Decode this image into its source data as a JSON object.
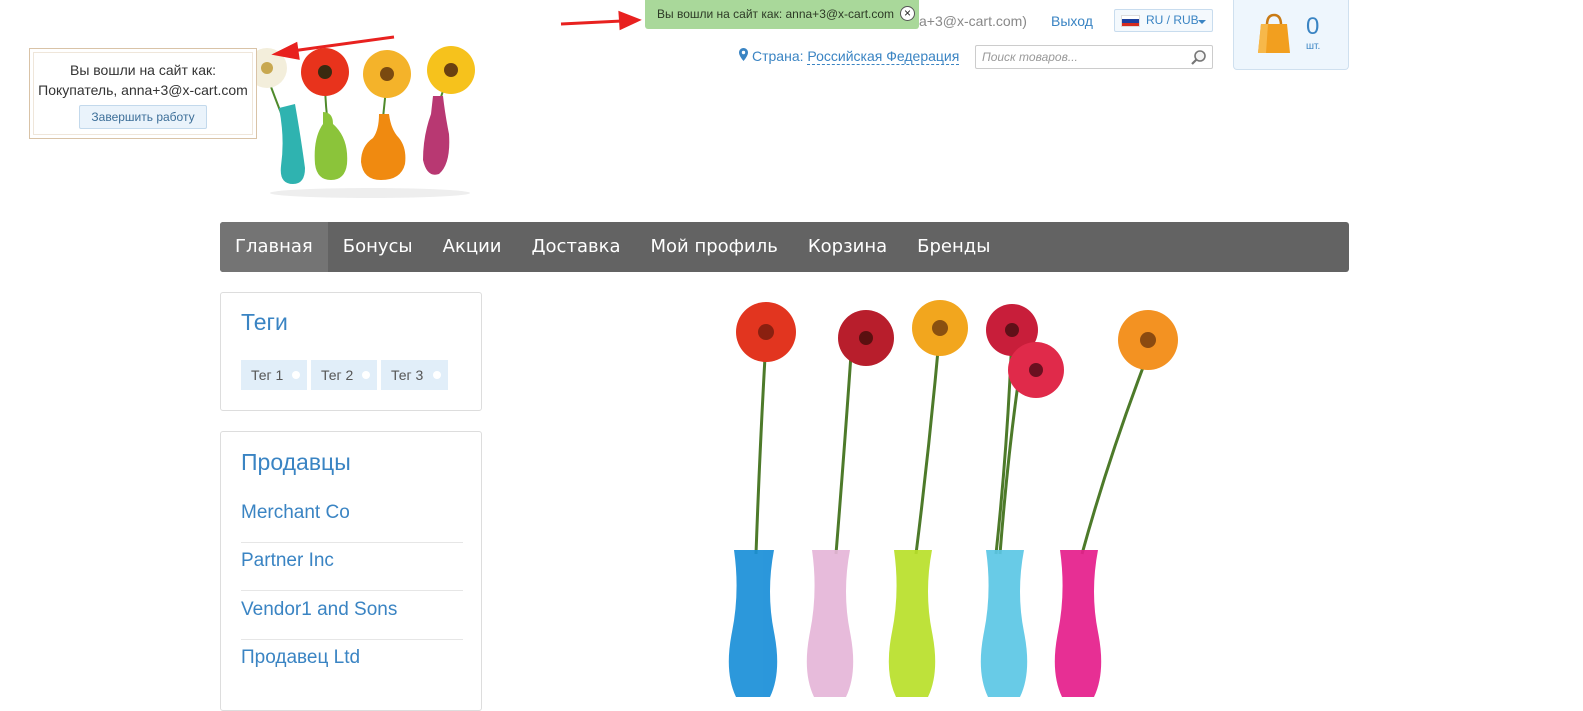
{
  "impersonation_panel": {
    "line1": "Вы вошли на сайт как:",
    "line2": "Покупатель, anna+3@x-cart.com",
    "finish_button": "Завершить работу"
  },
  "notification": {
    "text": "Вы вошли на сайт как: anna+3@x-cart.com",
    "close_icon": "close-icon",
    "background": "#a9d89a"
  },
  "header": {
    "account_tail": "a+3@x-cart.com)",
    "logout": "Выход",
    "language": {
      "label": "RU / RUB",
      "flag_icon": "russia-flag-icon"
    },
    "country": {
      "label": "Страна:",
      "value": "Российская Федерация",
      "icon": "map-pin-icon"
    },
    "search": {
      "placeholder": "Поиск товаров...",
      "value": "",
      "icon": "search-icon"
    },
    "cart": {
      "count": "0",
      "unit": "шт.",
      "icon": "shopping-bag-icon"
    }
  },
  "nav": {
    "items": [
      {
        "label": "Главная",
        "active": true
      },
      {
        "label": "Бонусы"
      },
      {
        "label": "Акции"
      },
      {
        "label": "Доставка"
      },
      {
        "label": "Мой профиль"
      },
      {
        "label": "Корзина"
      },
      {
        "label": "Бренды"
      }
    ]
  },
  "sidebar": {
    "tags": {
      "title": "Теги",
      "items": [
        "Тег 1",
        "Тег 2",
        "Тег 3"
      ]
    },
    "vendors": {
      "title": "Продавцы",
      "items": [
        "Merchant Co",
        "Partner Inc",
        "Vendor1 and Sons",
        "Продавец Ltd"
      ]
    }
  },
  "colors": {
    "accent": "#3a84c3",
    "nav_bg": "#636363",
    "arrow": "#e8211f",
    "tag_bg": "#e1eef9"
  }
}
